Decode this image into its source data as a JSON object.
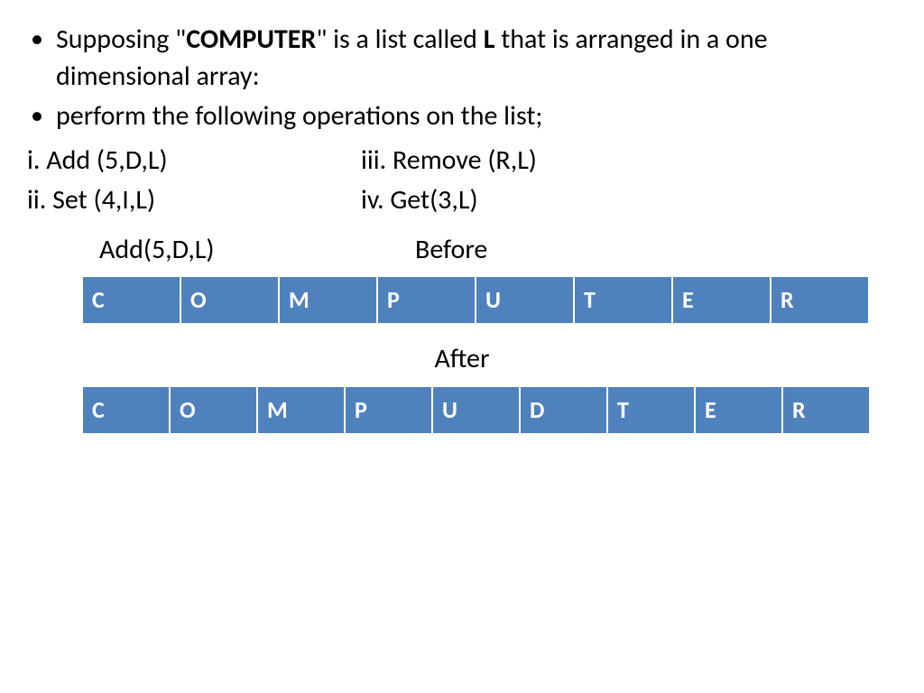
{
  "bullets": [
    {
      "pre": "Supposing \"",
      "bold1": "COMPUTER",
      "mid": "\" is a list called ",
      "bold2": "L",
      "post": " that is arranged in a one dimensional array:"
    },
    {
      "text": "perform the following operations on the list;"
    }
  ],
  "ops": {
    "left": [
      "i. Add (5,D,L)",
      "ii. Set (4,I,L)"
    ],
    "right": [
      "iii.   Remove (R,L)",
      "iv. Get(3,L)"
    ]
  },
  "example": {
    "operation": "Add(5,D,L)",
    "before_label": "Before",
    "after_label": "After",
    "before": [
      "C",
      "O",
      "M",
      "P",
      "U",
      "T",
      "E",
      "R"
    ],
    "after": [
      "C",
      "O",
      "M",
      "P",
      "U",
      "D",
      "T",
      "E",
      "R"
    ]
  }
}
